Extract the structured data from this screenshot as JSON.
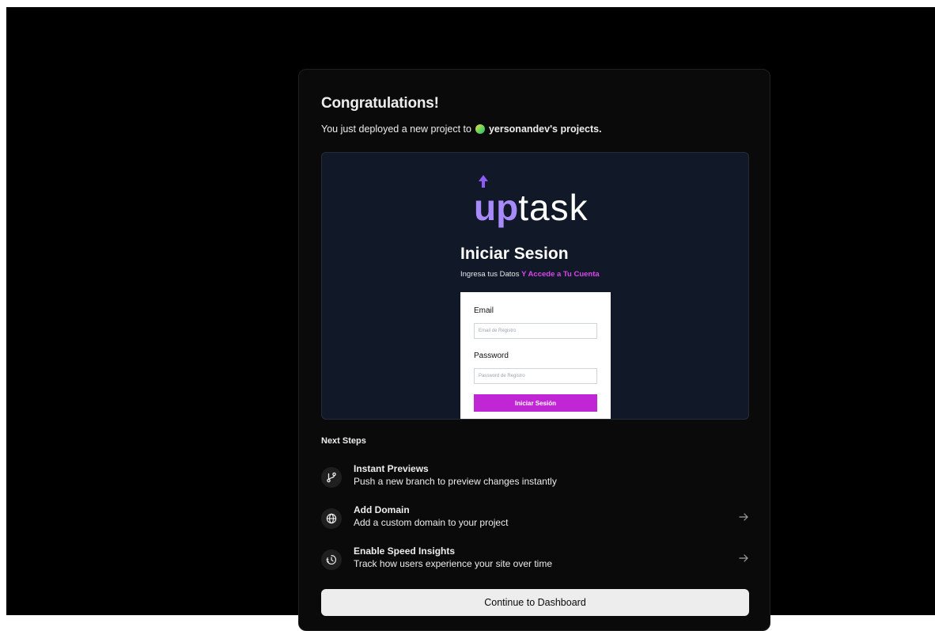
{
  "card": {
    "title": "Congratulations!",
    "subtitle_prefix": "You just deployed a new project to",
    "team_name": "yersonandev's projects.",
    "team_avatar_color": "#5fd35f"
  },
  "preview": {
    "logo_up": "up",
    "logo_task": "task",
    "heading": "Iniciar Sesion",
    "subheading_plain": "Ingresa tus Datos",
    "subheading_accent": "Y Accede a Tu Cuenta",
    "accent_color": "#d946ef",
    "email_label": "Email",
    "email_placeholder": "Email de Registro",
    "password_label": "Password",
    "password_placeholder": "Password de Registro",
    "submit_label": "Iniciar Sesión",
    "submit_color": "#c026d3"
  },
  "next_steps": {
    "label": "Next Steps",
    "items": [
      {
        "icon": "git-branch-icon",
        "title": "Instant Previews",
        "description": "Push a new branch to preview changes instantly"
      },
      {
        "icon": "globe-icon",
        "title": "Add Domain",
        "description": "Add a custom domain to your project"
      },
      {
        "icon": "speed-insights-icon",
        "title": "Enable Speed Insights",
        "description": "Track how users experience your site over time"
      }
    ]
  },
  "continue_label": "Continue to Dashboard"
}
